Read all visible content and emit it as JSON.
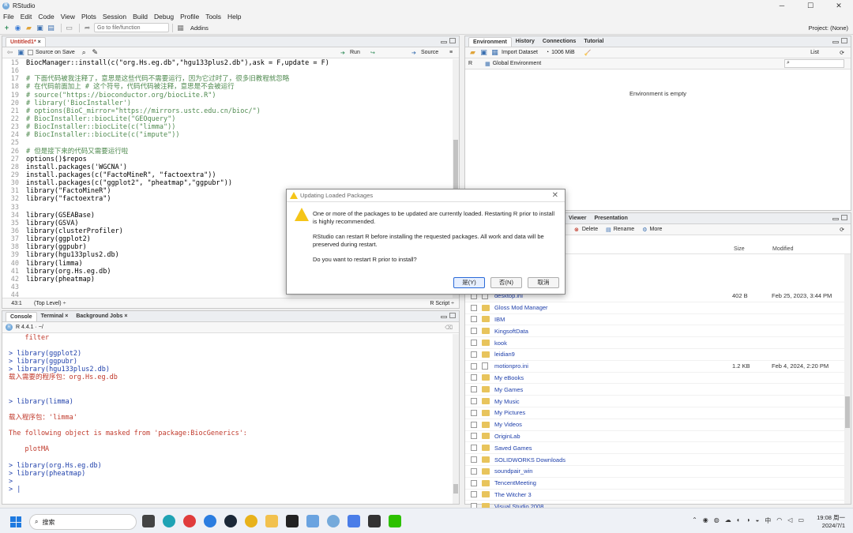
{
  "window": {
    "title": "RStudio",
    "controls": [
      "─",
      "☐",
      "✕"
    ]
  },
  "menu": [
    "File",
    "Edit",
    "Code",
    "View",
    "Plots",
    "Session",
    "Build",
    "Debug",
    "Profile",
    "Tools",
    "Help"
  ],
  "toolbar": {
    "goto_placeholder": "Go to file/function",
    "addins": "Addins",
    "project": "Project: (None)"
  },
  "editor": {
    "tab": "Untitled1*",
    "source_on_save": "Source on Save",
    "run": "Run",
    "source": "Source",
    "lines": [
      {
        "n": "15",
        "code": "BiocManager::install(c(\"org.Hs.eg.db\",\"hgu133plus2.db\"),ask = F,update = F)"
      },
      {
        "n": "16",
        "code": ""
      },
      {
        "n": "17",
        "code": "# 下面代码被我注释了，意思是这些代码不需要运行，因为它过时了，很多旧教程就忽略"
      },
      {
        "n": "18",
        "code": "# 在代码前面加上 # 这个符号，代码代码被注释，意思是不会被运行"
      },
      {
        "n": "19",
        "code": "# source(\"https://bioconductor.org/biocLite.R\")"
      },
      {
        "n": "20",
        "code": "# library('BiocInstaller')"
      },
      {
        "n": "21",
        "code": "# options(BioC_mirror=\"https://mirrors.ustc.edu.cn/bioc/\")"
      },
      {
        "n": "22",
        "code": "# BiocInstaller::biocLite(\"GEOquery\")"
      },
      {
        "n": "23",
        "code": "# BiocInstaller::biocLite(c(\"limma\"))"
      },
      {
        "n": "24",
        "code": "# BiocInstaller::biocLite(c(\"impute\"))"
      },
      {
        "n": "25",
        "code": ""
      },
      {
        "n": "26",
        "code": "# 但是接下来的代码又需要运行啦"
      },
      {
        "n": "27",
        "code": "options()$repos"
      },
      {
        "n": "28",
        "code": "install.packages('WGCNA')"
      },
      {
        "n": "29",
        "code": "install.packages(c(\"FactoMineR\", \"factoextra\"))"
      },
      {
        "n": "30",
        "code": "install.packages(c(\"ggplot2\", \"pheatmap\",\"ggpubr\"))"
      },
      {
        "n": "31",
        "code": "library(\"FactoMineR\")"
      },
      {
        "n": "32",
        "code": "library(\"factoextra\")"
      },
      {
        "n": "33",
        "code": ""
      },
      {
        "n": "34",
        "code": "library(GSEABase)"
      },
      {
        "n": "35",
        "code": "library(GSVA)"
      },
      {
        "n": "36",
        "code": "library(clusterProfiler)"
      },
      {
        "n": "37",
        "code": "library(ggplot2)"
      },
      {
        "n": "38",
        "code": "library(ggpubr)"
      },
      {
        "n": "39",
        "code": "library(hgu133plus2.db)"
      },
      {
        "n": "40",
        "code": "library(limma)"
      },
      {
        "n": "41",
        "code": "library(org.Hs.eg.db)"
      },
      {
        "n": "42",
        "code": "library(pheatmap)"
      },
      {
        "n": "43",
        "code": ""
      },
      {
        "n": "44",
        "code": ""
      }
    ],
    "status_pos": "43:1",
    "status_scope": "(Top Level) ÷",
    "status_lang": "R Script ÷"
  },
  "console": {
    "tabs": [
      "Console",
      "Terminal",
      "Background Jobs"
    ],
    "version": "R 4.4.1 · ~/",
    "lines": [
      {
        "t": "msg",
        "text": "    filter"
      },
      {
        "t": "blank",
        "text": ""
      },
      {
        "t": "cmd",
        "text": "> library(ggplot2)"
      },
      {
        "t": "cmd",
        "text": "> library(ggpubr)"
      },
      {
        "t": "cmd",
        "text": "> library(hgu133plus2.db)"
      },
      {
        "t": "msg",
        "text": "载入需要的程序包：org.Hs.eg.db"
      },
      {
        "t": "blank",
        "text": ""
      },
      {
        "t": "blank",
        "text": ""
      },
      {
        "t": "cmd",
        "text": "> library(limma)"
      },
      {
        "t": "blank",
        "text": ""
      },
      {
        "t": "msg",
        "text": "载入程序包：'limma'"
      },
      {
        "t": "blank",
        "text": ""
      },
      {
        "t": "msg",
        "text": "The following object is masked from 'package:BiocGenerics':"
      },
      {
        "t": "blank",
        "text": ""
      },
      {
        "t": "msg",
        "text": "    plotMA"
      },
      {
        "t": "blank",
        "text": ""
      },
      {
        "t": "cmd",
        "text": "> library(org.Hs.eg.db)"
      },
      {
        "t": "cmd",
        "text": "> library(pheatmap)"
      },
      {
        "t": "cmd",
        "text": ">"
      },
      {
        "t": "cmd",
        "text": "> |"
      }
    ]
  },
  "environment": {
    "tabs": [
      "Environment",
      "History",
      "Connections",
      "Tutorial"
    ],
    "import_dataset": "Import Dataset",
    "memory": "1006 MiB",
    "list": "List",
    "r_select": "R",
    "global_env": "Global Environment",
    "empty_text": "Environment is empty"
  },
  "files": {
    "tabs": [
      "Viewer",
      "Presentation"
    ],
    "delete": "Delete",
    "rename": "Rename",
    "more": "More",
    "col_size": "Size",
    "col_modified": "Modified",
    "rows": [
      {
        "name": "desktop.ini",
        "type": "file",
        "size": "402 B",
        "modified": "Feb 25, 2023, 3:44 PM"
      },
      {
        "name": "Gloss Mod Manager",
        "type": "folder",
        "size": "",
        "modified": ""
      },
      {
        "name": "IBM",
        "type": "folder",
        "size": "",
        "modified": ""
      },
      {
        "name": "KingsoftData",
        "type": "folder",
        "size": "",
        "modified": ""
      },
      {
        "name": "kook",
        "type": "folder",
        "size": "",
        "modified": ""
      },
      {
        "name": "leidian9",
        "type": "folder",
        "size": "",
        "modified": ""
      },
      {
        "name": "motionpro.ini",
        "type": "file",
        "size": "1.2 KB",
        "modified": "Feb 4, 2024, 2:20 PM"
      },
      {
        "name": "My eBooks",
        "type": "folder",
        "size": "",
        "modified": ""
      },
      {
        "name": "My Games",
        "type": "folder",
        "size": "",
        "modified": ""
      },
      {
        "name": "My Music",
        "type": "folder",
        "size": "",
        "modified": ""
      },
      {
        "name": "My Pictures",
        "type": "folder",
        "size": "",
        "modified": ""
      },
      {
        "name": "My Videos",
        "type": "folder",
        "size": "",
        "modified": ""
      },
      {
        "name": "OriginLab",
        "type": "folder",
        "size": "",
        "modified": ""
      },
      {
        "name": "Saved Games",
        "type": "folder",
        "size": "",
        "modified": ""
      },
      {
        "name": "SOLIDWORKS Downloads",
        "type": "folder",
        "size": "",
        "modified": ""
      },
      {
        "name": "soundpair_win",
        "type": "folder",
        "size": "",
        "modified": ""
      },
      {
        "name": "TencentMeeting",
        "type": "folder",
        "size": "",
        "modified": ""
      },
      {
        "name": "The Witcher 3",
        "type": "folder",
        "size": "",
        "modified": ""
      },
      {
        "name": "Visual Studio 2008",
        "type": "folder",
        "size": "",
        "modified": ""
      }
    ]
  },
  "dialog": {
    "title": "Updating Loaded Packages",
    "p1": "One or more of the packages to be updated are currently loaded. Restarting R prior to install is highly recommended.",
    "p2": "RStudio can restart R before installing the requested packages. All work and data will be preserved during restart.",
    "p3": "Do you want to restart R prior to install?",
    "yes": "是(Y)",
    "no": "否(N)",
    "cancel": "取消"
  },
  "taskbar": {
    "search": "搜索",
    "time": "19:08 周一",
    "date": "2024/7/1",
    "ime": "中"
  },
  "colors": {
    "accent": "#2a6ad8",
    "comment": "#4f8a4f",
    "console_msg": "#c0392b",
    "console_cmd": "#1e3faa"
  }
}
